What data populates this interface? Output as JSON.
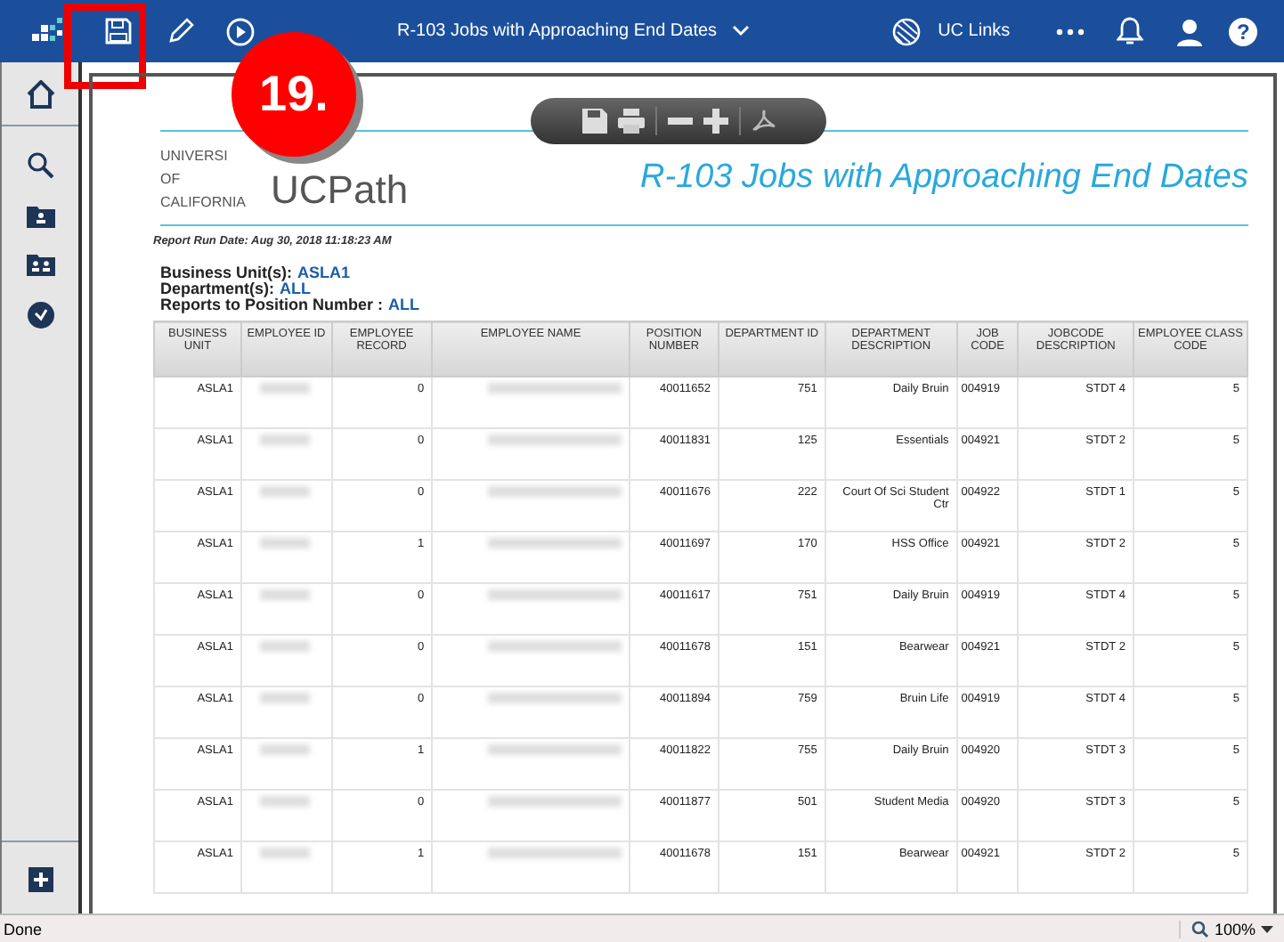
{
  "top_bar": {
    "title": "R-103 Jobs with Approaching End Dates",
    "links_label": "UC Links",
    "help": "?"
  },
  "annotation": {
    "step": "19."
  },
  "report": {
    "logo": {
      "line_1": "UNIVERSI",
      "line_2": "OF",
      "line_3": "CALIFORNIA",
      "brand": "UCPath"
    },
    "title": "R-103 Jobs with Approaching End Dates",
    "run_date": "Report Run Date: Aug 30, 2018   11:18:23 AM",
    "filters": [
      {
        "label": "Business Unit(s):",
        "value": "ASLA1"
      },
      {
        "label": "Department(s):",
        "value": "ALL"
      },
      {
        "label": "Reports to Position Number :",
        "value": "ALL"
      }
    ],
    "table": {
      "columns": [
        "BUSINESS UNIT",
        "EMPLOYEE ID",
        "EMPLOYEE RECORD",
        "EMPLOYEE NAME",
        "POSITION NUMBER",
        "DEPARTMENT ID",
        "DEPARTMENT DESCRIPTION",
        "JOB CODE",
        "JOBCODE DESCRIPTION",
        "EMPLOYEE CLASS CODE"
      ],
      "rows": [
        {
          "business_unit": "ASLA1",
          "employee_record": "0",
          "position_number": "40011652",
          "department_id": "751",
          "department_description": "Daily Bruin",
          "job_code": "004919",
          "jobcode_description": "STDT 4",
          "employee_class_code": "5"
        },
        {
          "business_unit": "ASLA1",
          "employee_record": "0",
          "position_number": "40011831",
          "department_id": "125",
          "department_description": "Essentials",
          "job_code": "004921",
          "jobcode_description": "STDT 2",
          "employee_class_code": "5"
        },
        {
          "business_unit": "ASLA1",
          "employee_record": "0",
          "position_number": "40011676",
          "department_id": "222",
          "department_description": "Court Of Sci Student Ctr",
          "job_code": "004922",
          "jobcode_description": "STDT 1",
          "employee_class_code": "5"
        },
        {
          "business_unit": "ASLA1",
          "employee_record": "1",
          "position_number": "40011697",
          "department_id": "170",
          "department_description": "HSS Office",
          "job_code": "004921",
          "jobcode_description": "STDT 2",
          "employee_class_code": "5"
        },
        {
          "business_unit": "ASLA1",
          "employee_record": "0",
          "position_number": "40011617",
          "department_id": "751",
          "department_description": "Daily Bruin",
          "job_code": "004919",
          "jobcode_description": "STDT 4",
          "employee_class_code": "5"
        },
        {
          "business_unit": "ASLA1",
          "employee_record": "0",
          "position_number": "40011678",
          "department_id": "151",
          "department_description": "Bearwear",
          "job_code": "004921",
          "jobcode_description": "STDT 2",
          "employee_class_code": "5"
        },
        {
          "business_unit": "ASLA1",
          "employee_record": "0",
          "position_number": "40011894",
          "department_id": "759",
          "department_description": "Bruin Life",
          "job_code": "004919",
          "jobcode_description": "STDT 4",
          "employee_class_code": "5"
        },
        {
          "business_unit": "ASLA1",
          "employee_record": "1",
          "position_number": "40011822",
          "department_id": "755",
          "department_description": "Daily Bruin",
          "job_code": "004920",
          "jobcode_description": "STDT 3",
          "employee_class_code": "5"
        },
        {
          "business_unit": "ASLA1",
          "employee_record": "0",
          "position_number": "40011877",
          "department_id": "501",
          "department_description": "Student Media",
          "job_code": "004920",
          "jobcode_description": "STDT 3",
          "employee_class_code": "5"
        },
        {
          "business_unit": "ASLA1",
          "employee_record": "1",
          "position_number": "40011678",
          "department_id": "151",
          "department_description": "Bearwear",
          "job_code": "004921",
          "jobcode_description": "STDT 2",
          "employee_class_code": "5"
        }
      ]
    }
  },
  "status_bar": {
    "text": "Done",
    "zoom": "100%"
  }
}
